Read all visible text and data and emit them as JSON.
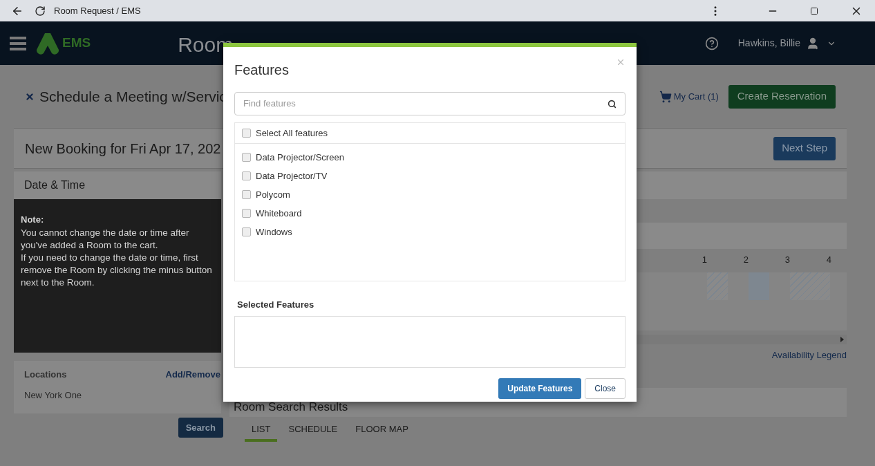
{
  "browser": {
    "title": "Room Request / EMS"
  },
  "header": {
    "logo": "EMS",
    "title": "Room",
    "user": "Hawkins, Billie"
  },
  "page": {
    "heading": "Schedule a Meeting w/Servic",
    "cart": "My Cart (1)",
    "create_button": "Create Reservation",
    "booking_title": "New Booking for Fri Apr 17, 202",
    "next_button": "Next Step"
  },
  "date_time": {
    "heading": "Date & Time",
    "note_title": "Note:",
    "note_paragraphs": [
      "You cannot change the date or time after you've added a Room to the cart.",
      "If you need to change the date or time, first remove the Room by clicking the minus button next to the Room."
    ]
  },
  "locations": {
    "heading": "Locations",
    "action": "Add/Remove",
    "items": [
      "New York One"
    ],
    "search_button": "Search"
  },
  "schedule": {
    "hours": [
      "1",
      "2",
      "3",
      "4"
    ],
    "legend_link": "Availability Legend"
  },
  "results": {
    "heading": "Room Search Results",
    "tabs": [
      {
        "label": "LIST",
        "selected": true
      },
      {
        "label": "SCHEDULE",
        "selected": false
      },
      {
        "label": "FLOOR MAP",
        "selected": false
      }
    ]
  },
  "modal": {
    "title": "Features",
    "search_placeholder": "Find features",
    "select_all": {
      "label": "Select All features",
      "checked": false
    },
    "features": [
      {
        "label": "Data Projector/Screen",
        "checked": false
      },
      {
        "label": "Data Projector/TV",
        "checked": false
      },
      {
        "label": "Polycom",
        "checked": false
      },
      {
        "label": "Whiteboard",
        "checked": false
      },
      {
        "label": "Windows",
        "checked": false
      }
    ],
    "selected_heading": "Selected Features",
    "primary_button": "Update Features",
    "secondary_button": "Close"
  }
}
